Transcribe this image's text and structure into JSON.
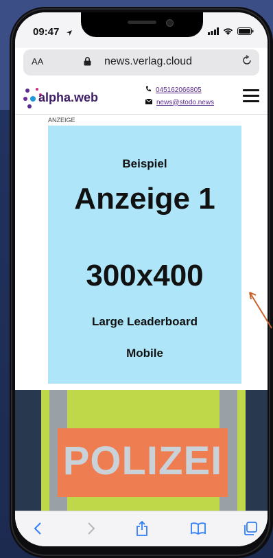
{
  "status_bar": {
    "time": "09:47"
  },
  "address_bar": {
    "text_size": "AA",
    "url": "news.verlag.cloud"
  },
  "site": {
    "logo": "alpha.web",
    "phone": "045162066805",
    "email": "news@stodo.news"
  },
  "ad": {
    "label": "ANZEIGE",
    "line1": "Beispiel",
    "line2": "Anzeige 1",
    "line3": "300x400",
    "line4": "Large Leaderboard",
    "line5": "Mobile"
  },
  "photo": {
    "text": "POLIZEI"
  },
  "colors": {
    "accent": "#5b2b8c",
    "ad_background": "#aee5f8",
    "frame_background": "#3c4e86"
  }
}
